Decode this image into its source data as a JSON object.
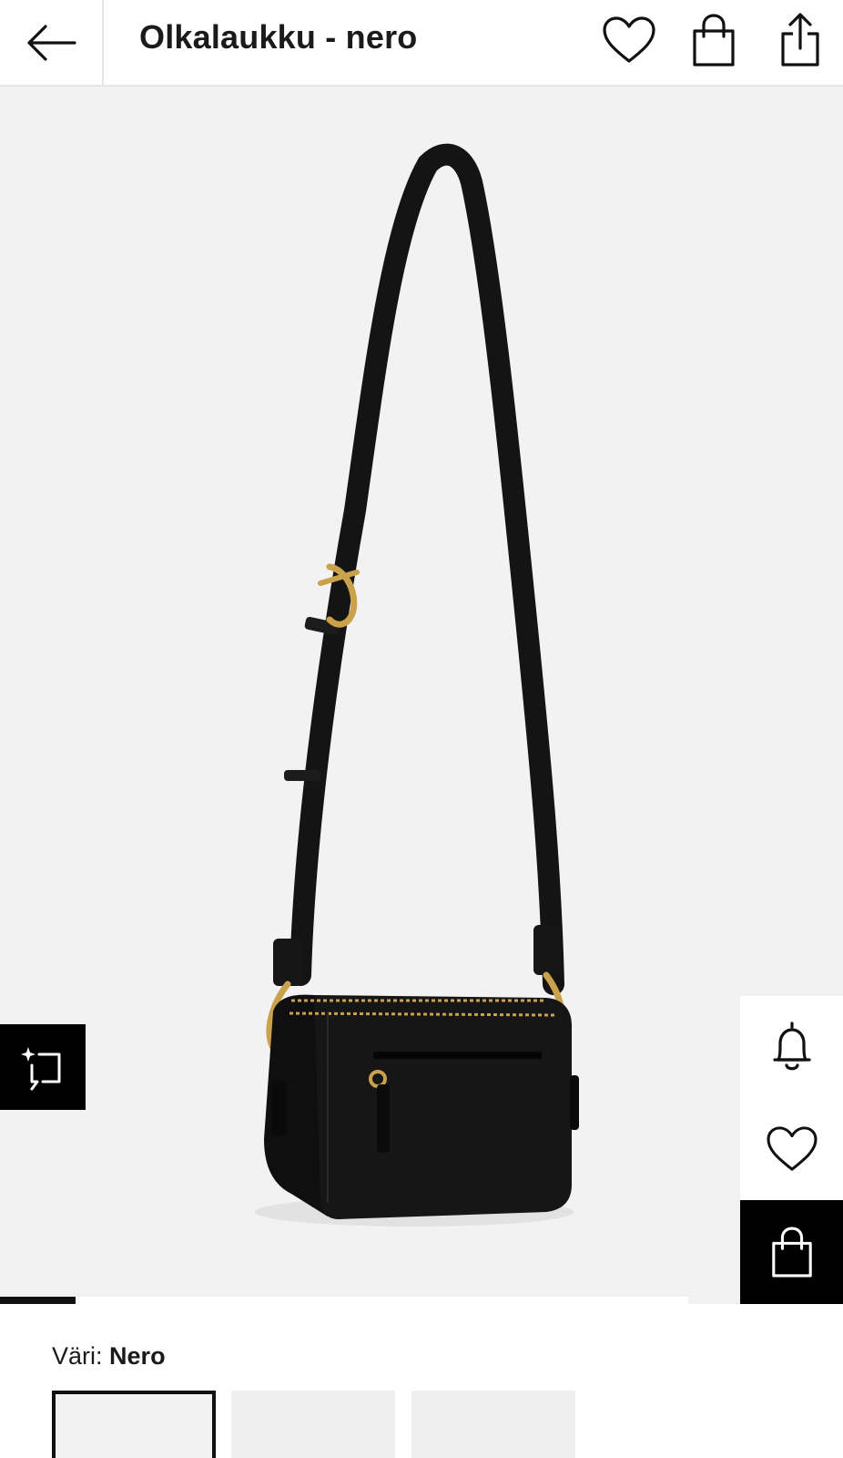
{
  "header": {
    "title": "Olkalaukku - nero"
  },
  "icons": {
    "back": "arrow-left-icon",
    "wishlist": "heart-icon",
    "bag": "shopping-bag-icon",
    "share": "share-icon",
    "visual_search": "sparkle-crop-icon",
    "notify": "bell-icon",
    "side_wishlist": "heart-icon",
    "side_bag": "shopping-bag-icon"
  },
  "gallery": {
    "image_alt": "Black shoulder bag with adjustable strap",
    "progress_fraction": 0.11
  },
  "color": {
    "label": "Väri:",
    "value": "Nero"
  },
  "swatches": [
    {
      "selected": true
    },
    {
      "selected": false
    },
    {
      "selected": false
    }
  ],
  "colors": {
    "accent": "#000000",
    "background": "#f2f2f2",
    "bag": "#151515",
    "hardware": "#c9a24b"
  }
}
